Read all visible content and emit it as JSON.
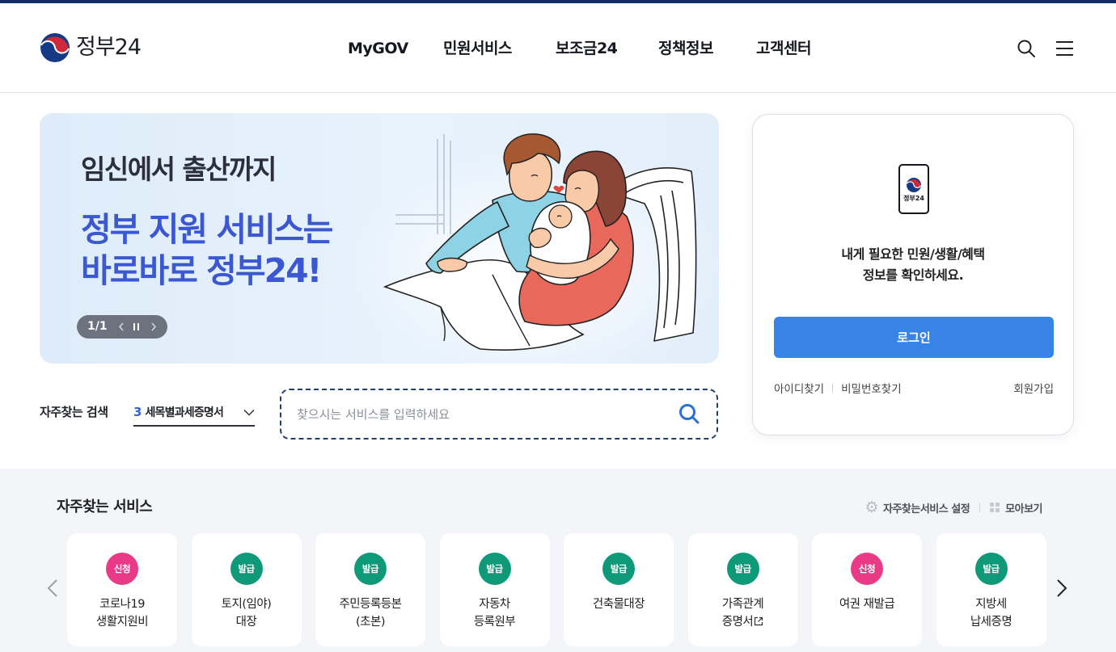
{
  "header": {
    "logo_text": "정부24",
    "nav": [
      "MyGOV",
      "민원서비스",
      "보조금24",
      "정책정보",
      "고객센터"
    ],
    "icons": {
      "search": "search-icon",
      "menu": "menu-icon"
    }
  },
  "banner": {
    "headline": "임신에서 출산까지",
    "title_lines": [
      "정부 지원 서비스는",
      "바로바로 정부24!"
    ],
    "pager": {
      "label": "1/1",
      "prev_icon": "chevron-left-icon",
      "pause_icon": "pause-icon",
      "next_icon": "chevron-right-icon"
    }
  },
  "login": {
    "app_label": "정부24",
    "message_lines": [
      "내게 필요한 민원/생활/혜택",
      "정보를 확인하세요."
    ],
    "button_label": "로그인",
    "links": {
      "find_id": "아이디찾기",
      "find_password": "비밀번호찾기",
      "signup": "회원가입"
    }
  },
  "search": {
    "popular_label": "자주찾는 검색",
    "popular_rank": "3",
    "popular_keyword": "세목별과세증명서",
    "placeholder": "찾으시는 서비스를 입력하세요",
    "icon": "search-icon"
  },
  "services": {
    "title": "자주찾는 서비스",
    "settings_label": "자주찾는서비스 설정",
    "settings_icon": "gear-icon",
    "view_all_label": "모아보기",
    "view_all_icon": "grid-icon",
    "items": [
      {
        "badge": "신청",
        "lines": [
          "코로나19",
          "생활지원비"
        ]
      },
      {
        "badge": "발급",
        "lines": [
          "토지(임야)",
          "대장"
        ]
      },
      {
        "badge": "발급",
        "lines": [
          "주민등록등본",
          "(초본)"
        ]
      },
      {
        "badge": "발급",
        "lines": [
          "자동차",
          "등록원부"
        ]
      },
      {
        "badge": "발급",
        "lines": [
          "건축물대장"
        ]
      },
      {
        "badge": "발급",
        "lines": [
          "가족관계",
          "증명서"
        ],
        "icon": "external-link-icon"
      },
      {
        "badge": "신청",
        "lines": [
          "여권 재발급"
        ]
      },
      {
        "badge": "발급",
        "lines": [
          "지방세",
          "납세증명"
        ]
      }
    ]
  },
  "colors": {
    "top_bar": "#0f2e6b",
    "banner_title": "#3b57d1",
    "login_button": "#3884e6",
    "popular_rank": "#2f64d8",
    "search_icon": "#2c6fd8",
    "badge_apply": "#ea3a87",
    "badge_issue": "#0e9a78",
    "section_background": "#f3f5f9"
  }
}
